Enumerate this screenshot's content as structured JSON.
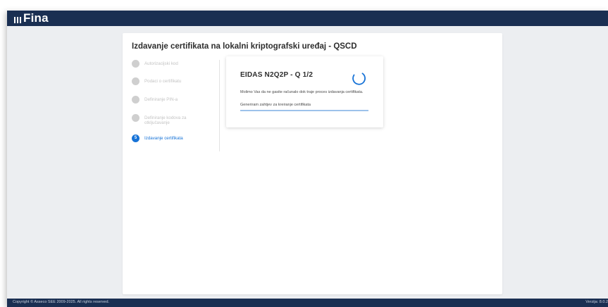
{
  "header": {
    "logo_text": "Fina"
  },
  "page": {
    "title": "Izdavanje certifikata na lokalni kriptografski uređaj - QSCD"
  },
  "steps": [
    {
      "number": "1",
      "label": "Autorizacijski kod",
      "active": false
    },
    {
      "number": "2",
      "label": "Podaci o certifikatu",
      "active": false
    },
    {
      "number": "3",
      "label": "Definiranje PIN-a",
      "active": false
    },
    {
      "number": "4",
      "label": "Definiranje kodova za otključavanje",
      "active": false
    },
    {
      "number": "5",
      "label": "Izdavanje certifikata",
      "active": true
    }
  ],
  "panel": {
    "title": "EIDAS N2Q2P - Q 1/2",
    "message": "Molimo Vas da ne gasite računalo dok traje proces izdavanja certifikata.",
    "status": "Generiram zahtjev za kreiranje certifikata",
    "progress": 1.0
  },
  "footer": {
    "copyright": "Copyright © Asseco SEE 2009-2025. All rights reserved.",
    "version": "Verzija: 8.0.2"
  },
  "colors": {
    "header_bg": "#1a2f52",
    "accent": "#1773d7"
  }
}
